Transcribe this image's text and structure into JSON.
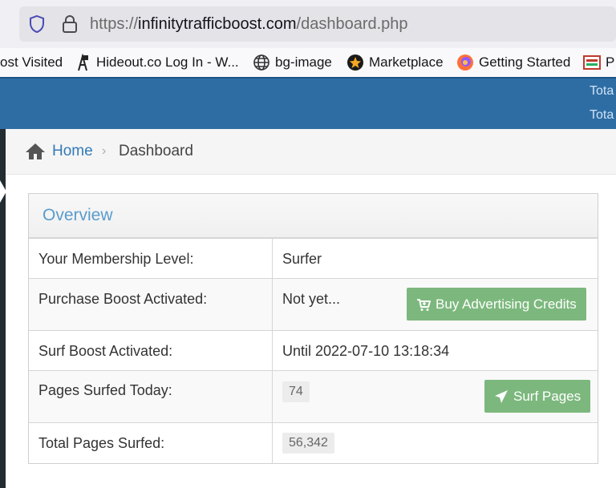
{
  "browser": {
    "url_prefix": "https://",
    "url_domain": "infinitytrafficboost.com",
    "url_path": "/dashboard.php"
  },
  "bookmarks": [
    {
      "label": "ost Visited",
      "icon": "none"
    },
    {
      "label": "Hideout.co Log In - W...",
      "icon": "hideout-icon"
    },
    {
      "label": "bg-image",
      "icon": "globe-icon"
    },
    {
      "label": "Marketplace",
      "icon": "star-icon"
    },
    {
      "label": "Getting Started",
      "icon": "firefox-icon"
    },
    {
      "label": "P",
      "icon": "bookmark-icon"
    }
  ],
  "header": {
    "stat1": "Tota",
    "stat2": "Tota"
  },
  "breadcrumb": {
    "home": "Home",
    "separator": "›",
    "current": "Dashboard"
  },
  "panel": {
    "title": "Overview",
    "rows": [
      {
        "label": "Your Membership Level:",
        "value": "Surfer"
      },
      {
        "label": "Purchase Boost Activated:",
        "value": "Not yet...",
        "button": "Buy Advertising Credits"
      },
      {
        "label": "Surf Boost Activated:",
        "value": "Until 2022-07-10 13:18:34"
      },
      {
        "label": "Pages Surfed Today:",
        "value": "74",
        "button": "Surf Pages"
      },
      {
        "label": "Total Pages Surfed:",
        "value": "56,342"
      }
    ]
  },
  "colors": {
    "header_blue": "#2e6da4",
    "button_green": "#7cb87d",
    "link_blue": "#337ab7",
    "title_blue": "#5a9ccc"
  }
}
